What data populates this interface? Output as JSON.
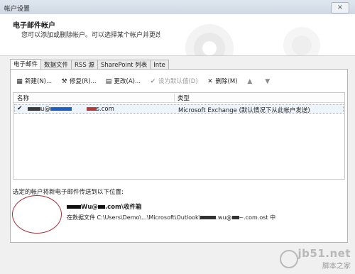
{
  "window": {
    "title": "帐户设置",
    "close_icon": "×"
  },
  "header": {
    "title": "电子邮件帐户",
    "description": "您可以添加或删除帐户。可以选择某个帐户并更改"
  },
  "tabs": [
    {
      "label": "电子邮件",
      "active": true
    },
    {
      "label": "数据文件"
    },
    {
      "label": "RSS 源"
    },
    {
      "label": "SharePoint 列表"
    },
    {
      "label": "Inte"
    }
  ],
  "toolbar": {
    "new_label": "新建(N)...",
    "repair_label": "修复(R)...",
    "change_label": "更改(A)...",
    "set_default_label": "设为默认值(D)",
    "remove_label": "删除(M)"
  },
  "accounts_list": {
    "columns": {
      "name": "名称",
      "type": "类型"
    },
    "rows": [
      {
        "name_prefix": "u@",
        "name_suffix": "s.com",
        "type": "Microsoft Exchange (默认情况下从此帐户发送)"
      }
    ]
  },
  "delivery": {
    "label": "选定的帐户将新电子邮件传送到以下位置:",
    "inbox_suffix": "Wu@",
    "inbox_tail": ".com\\收件箱",
    "datafile_prefix": "在数据文件 C:\\Users\\Demo\\...\\Microsoft\\Outlook\\",
    "datafile_mid": ".wu@",
    "datafile_tail": "~.com.ost 中"
  },
  "watermark": {
    "line1": "jb51.net",
    "line2": "脚本之家"
  },
  "colors": {
    "annotation_oval": "#a8323a",
    "selected_row": "#eef4fb",
    "window_bg": "#f0f0f0"
  }
}
